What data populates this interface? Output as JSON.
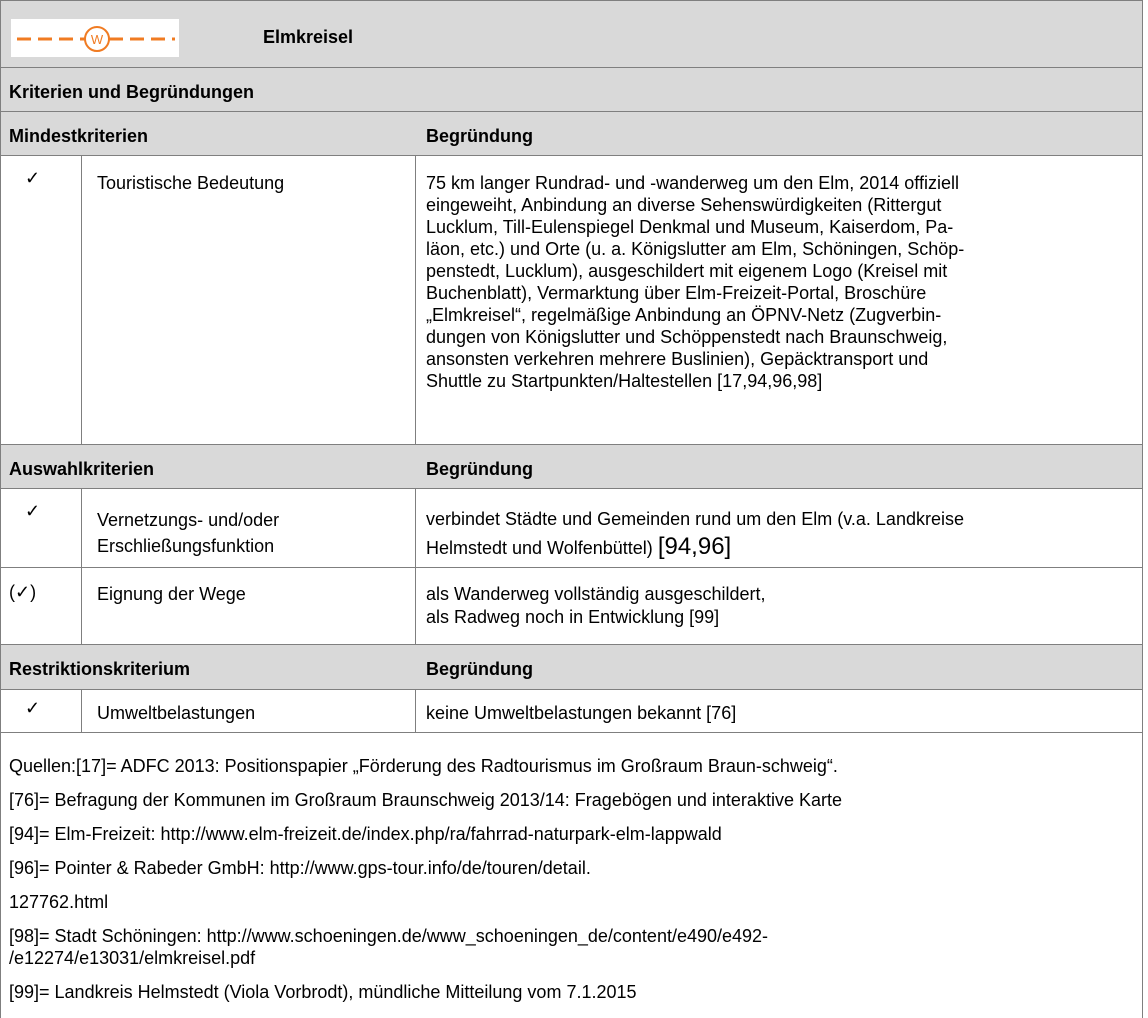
{
  "header": {
    "title": "Elmkreisel",
    "logo_letter": "W"
  },
  "section_title": "Kriterien und Begründungen",
  "mindest": {
    "heading": "Mindestkriterien",
    "begruendung_heading": "Begründung",
    "rows": [
      {
        "check": "✓",
        "criterion": "Touristische Bedeutung",
        "lines": [
          "75 km langer Rundrad- und -wanderweg um den Elm, 2014 offiziell",
          "eingeweiht, Anbindung an diverse Sehenswürdigkeiten (Rittergut",
          "Lucklum, Till-Eulenspiegel Denkmal und Museum, Kaiserdom, Pa-",
          "läon, etc.) und Orte (u. a. Königslutter am Elm, Schöningen, Schöp-",
          "penstedt, Lucklum), ausgeschildert mit eigenem Logo (Kreisel mit",
          "Buchenblatt), Vermarktung über Elm-Freizeit-Portal, Broschüre",
          "„Elmkreisel“, regelmäßige Anbindung an ÖPNV-Netz (Zugverbin-",
          "dungen von Königslutter und Schöppenstedt nach Braunschweig,",
          "ansonsten verkehren mehrere Buslinien), Gepäcktransport und",
          "Shuttle zu Startpunkten/Haltestellen [17,94,96,98]"
        ]
      }
    ]
  },
  "auswahl": {
    "heading": "Auswahlkriterien",
    "begruendung_heading": "Begründung",
    "rows": [
      {
        "check": "✓",
        "criterion_lines": [
          "Vernetzungs- und/oder",
          "Erschließungsfunktion"
        ],
        "lines": [
          "verbindet Städte und Gemeinden rund um den Elm (v.a. Landkreise",
          "Helmstedt und Wolfenbüttel)"
        ],
        "ref": "[94,96]"
      },
      {
        "check": "(✓)",
        "criterion_lines": [
          "Eignung der Wege"
        ],
        "lines": [
          "als Wanderweg vollständig ausgeschildert,",
          "als Radweg noch in Entwicklung [99]"
        ]
      }
    ]
  },
  "restriktion": {
    "heading": "Restriktionskriterium",
    "begruendung_heading": "Begründung",
    "rows": [
      {
        "check": "✓",
        "criterion": "Umweltbelastungen",
        "text": "keine Umweltbelastungen bekannt [76]"
      }
    ]
  },
  "sources": [
    "Quellen:[17]= ADFC 2013: Positionspapier „Förderung des Radtourismus im Großraum Braun-schweig“.",
    "[76]= Befragung der Kommunen im Großraum Braunschweig 2013/14: Fragebögen und interaktive Karte",
    "[94]= Elm-Freizeit: http://www.elm-freizeit.de/index.php/ra/fahrrad-naturpark-elm-lappwald",
    "[96]= Pointer & Rabeder GmbH: http://www.gps-tour.info/de/touren/detail.",
    "127762.html",
    "[98]= Stadt Schöningen: http://www.schoeningen.de/www_schoeningen_de/content/e490/e492-",
    "/e12274/e13031/elmkreisel.pdf",
    "[99]= Landkreis Helmstedt (Viola Vorbrodt), mündliche Mitteilung vom 7.1.2015"
  ]
}
